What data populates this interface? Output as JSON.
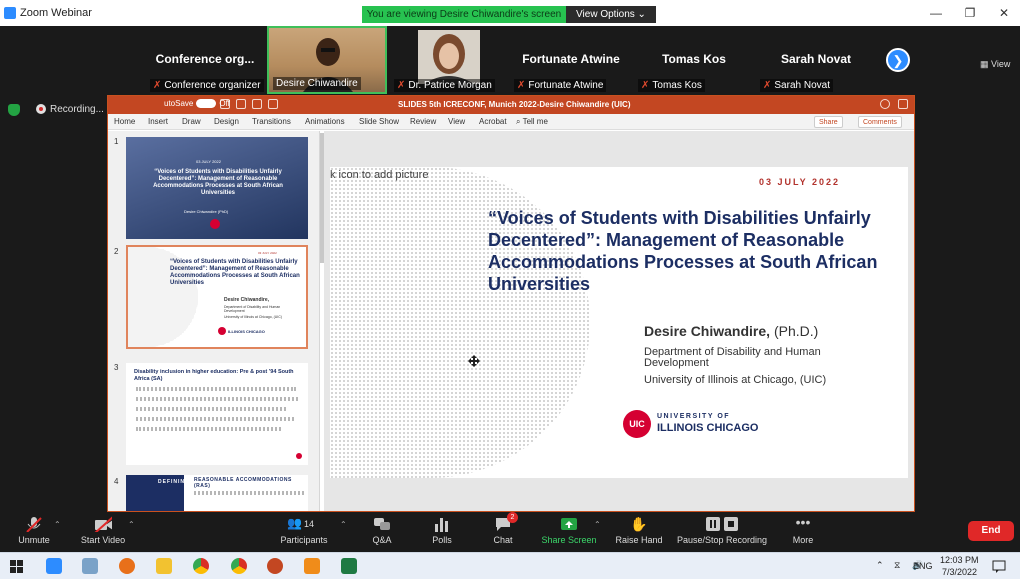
{
  "window": {
    "title": "Zoom Webinar",
    "viewing_banner": "You are viewing Desire Chiwandire's screen",
    "view_options": "View Options ⌄"
  },
  "window_controls": {
    "minimize": "—",
    "maximize": "❐",
    "close": "✕"
  },
  "participants": {
    "tiles": [
      {
        "name": "Conference org...",
        "label": "Conference organizer"
      },
      {
        "name": "",
        "label": "Desire Chiwandire"
      },
      {
        "name": "",
        "label": "Dr. Patrice Morgan"
      },
      {
        "name": "Fortunate Atwine",
        "label": "Fortunate Atwine"
      },
      {
        "name": "Tomas Kos",
        "label": "Tomas Kos"
      },
      {
        "name": "Sarah Novat",
        "label": "Sarah Novat"
      }
    ],
    "next": "❯",
    "grid_view": "View"
  },
  "recording": {
    "label": "Recording..."
  },
  "ppt": {
    "autosave": "utoSave",
    "autosave_state": "Off",
    "doc_title": "SLIDES 5th ICRECONF, Munich 2022-Desire Chiwandire (UIC)",
    "tabs": [
      "Home",
      "Insert",
      "Draw",
      "Design",
      "Transitions",
      "Animations",
      "Slide Show",
      "Review",
      "View",
      "Acrobat",
      "Tell me"
    ],
    "share": "Share",
    "comments": "Comments",
    "thumbnail_numbers": [
      "1",
      "2",
      "3",
      "4"
    ],
    "thumb1": {
      "date": "03 JULY 2022",
      "title": "“Voices of Students with Disabilities Unfairly Decentered”: Management of Reasonable Accommodations Processes at South African Universities",
      "author": "Desire Chiwandire (PhD)"
    },
    "thumb3": {
      "title": "Disability inclusion in higher education: Pre & post ’94 South Africa (SA)"
    },
    "thumb4": {
      "left": "DEFINING",
      "title": "REASONABLE ACCOMMODATIONS (RAS)"
    }
  },
  "slide": {
    "placeholder": "k icon to add picture",
    "date": "03 JULY 2022",
    "headline": "“Voices of Students with Disabilities Unfairly Decentered”: Management of Reasonable Accommodations Processes at South African Universities",
    "author": "Desire Chiwandire,",
    "degree": "(Ph.D.)",
    "department": "Department of Disability and Human Development",
    "university": "University of Illinois at Chicago, (UIC)",
    "logo_mark": "UIC",
    "logo_line1": "UNIVERSITY OF",
    "logo_line2": "ILLINOIS CHICAGO"
  },
  "toolbar": {
    "unmute": "Unmute",
    "start_video": "Start Video",
    "participants": "Participants",
    "participants_count": "14",
    "qa": "Q&A",
    "polls": "Polls",
    "chat": "Chat",
    "chat_badge": "2",
    "share_screen": "Share Screen",
    "raise_hand": "Raise Hand",
    "pause_recording": "Pause/Stop Recording",
    "more": "More",
    "end": "End"
  },
  "taskbar": {
    "lang": "ENG",
    "time": "12:03 PM",
    "date": "7/3/2022"
  },
  "colors": {
    "zoom_blue": "#2d8cff",
    "share_green": "#23a343",
    "ppt_orange": "#c34722",
    "end_red": "#e02828",
    "navy": "#1c2e63"
  }
}
